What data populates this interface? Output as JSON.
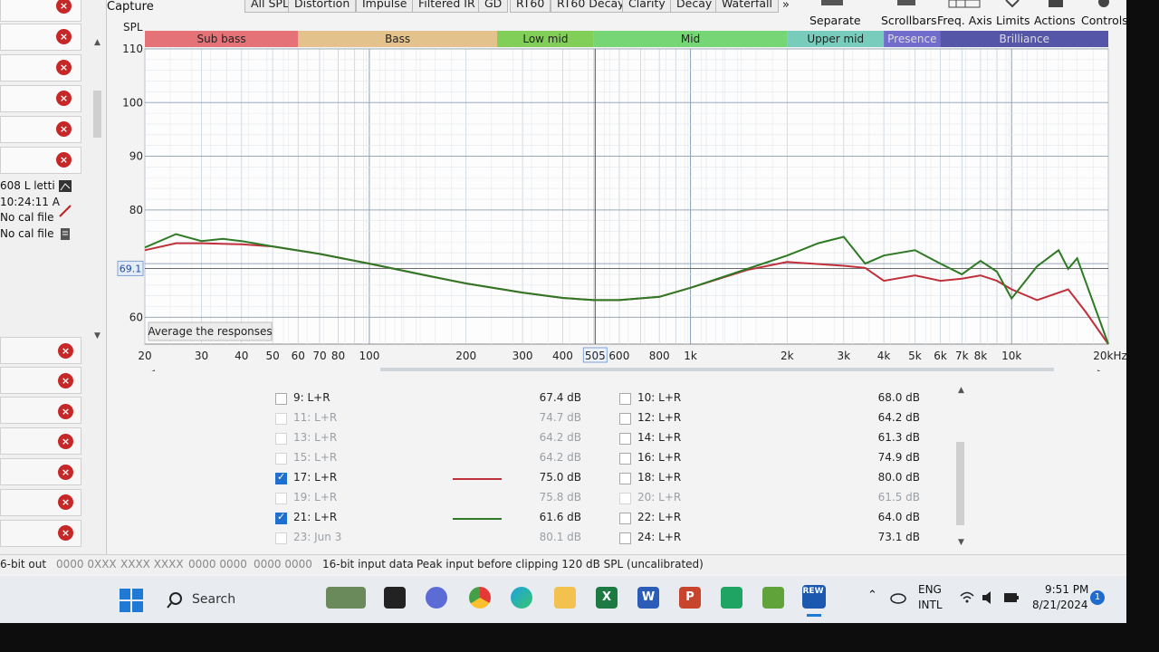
{
  "toolbar": {
    "capture": "Capture",
    "tabs": [
      "All SPL",
      "Distortion",
      "Impulse",
      "Filtered IR",
      "GD",
      "RT60",
      "RT60 Decay",
      "Clarity",
      "Decay",
      "Waterfall"
    ],
    "more": "»",
    "right_buttons": [
      "Separate",
      "Scrollbars",
      "Freq. Axis",
      "Limits",
      "Actions",
      "Controls"
    ]
  },
  "left_panel": {
    "info_lines": [
      "608 L letti",
      "10:24:11 A",
      "No cal file",
      "No cal file"
    ],
    "remove_icon": "×"
  },
  "graph": {
    "ylabel": "SPL",
    "y_ticks": [
      "110",
      "100",
      "90",
      "80",
      "60"
    ],
    "cursor_value": "69.1",
    "band_labels": [
      "Sub bass",
      "Bass",
      "Low mid",
      "Mid",
      "Upper mid",
      "Presence",
      "Brilliance"
    ],
    "band_colors": [
      "#e05a5f",
      "#e0b878",
      "#6cc83c",
      "#5fd05f",
      "#60c4b0",
      "#5b55c4",
      "#3a3a9a"
    ],
    "x_ticks": [
      "20",
      "30",
      "40",
      "50",
      "60",
      "70",
      "80",
      "100",
      "200",
      "300",
      "400",
      "505",
      "600",
      "800",
      "1k",
      "2k",
      "3k",
      "4k",
      "5k",
      "6k",
      "7k",
      "8k",
      "10k",
      "20kHz"
    ],
    "cursor_x_label": "505",
    "button": "Average the responses"
  },
  "chart_data": {
    "type": "line",
    "xlabel": "",
    "ylabel": "SPL",
    "xscale": "log",
    "xlim": [
      20,
      20000
    ],
    "ylim": [
      55,
      110
    ],
    "grid": true,
    "series": [
      {
        "name": "17: L+R",
        "color": "#c0303a",
        "x": [
          20,
          25,
          30,
          40,
          50,
          70,
          100,
          150,
          200,
          300,
          400,
          500,
          600,
          800,
          1000,
          1500,
          2000,
          3000,
          3500,
          4000,
          5000,
          6000,
          7000,
          8000,
          9000,
          10000,
          12000,
          15000,
          17000,
          20000
        ],
        "y": [
          72.5,
          73.8,
          73.8,
          73.6,
          73.2,
          71.8,
          70.0,
          67.8,
          66.3,
          64.6,
          63.6,
          63.2,
          63.2,
          63.8,
          65.5,
          68.8,
          70.3,
          69.6,
          69.2,
          66.8,
          67.8,
          66.8,
          67.2,
          67.8,
          66.8,
          65.2,
          63.2,
          65.2,
          61.0,
          50.0
        ]
      },
      {
        "name": "21: L+R",
        "color": "#2e7a24",
        "x": [
          20,
          25,
          30,
          35,
          40,
          50,
          70,
          100,
          150,
          200,
          300,
          400,
          500,
          600,
          800,
          1000,
          1500,
          2000,
          2500,
          3000,
          3500,
          4000,
          5000,
          6000,
          7000,
          8000,
          9000,
          10000,
          12000,
          14000,
          15000,
          16000,
          20000
        ],
        "y": [
          73.0,
          75.5,
          74.2,
          74.6,
          74.2,
          73.2,
          71.8,
          70.0,
          67.8,
          66.3,
          64.6,
          63.6,
          63.2,
          63.2,
          63.8,
          65.5,
          69.0,
          71.5,
          73.8,
          75.0,
          70.0,
          71.5,
          72.5,
          70.0,
          68.0,
          70.5,
          68.5,
          63.5,
          69.5,
          72.5,
          69.0,
          71.0,
          52.0
        ]
      }
    ]
  },
  "measurements": {
    "left": [
      {
        "name": "9: L+R",
        "value": "67.4 dB",
        "checked": false,
        "active": true,
        "color": ""
      },
      {
        "name": "11: L+R",
        "value": "74.7 dB",
        "checked": false,
        "active": false,
        "color": ""
      },
      {
        "name": "13: L+R",
        "value": "64.2 dB",
        "checked": false,
        "active": false,
        "color": ""
      },
      {
        "name": "15: L+R",
        "value": "64.2 dB",
        "checked": false,
        "active": false,
        "color": ""
      },
      {
        "name": "17: L+R",
        "value": "75.0 dB",
        "checked": true,
        "active": true,
        "color": "#c0303a"
      },
      {
        "name": "19: L+R",
        "value": "75.8 dB",
        "checked": false,
        "active": false,
        "color": ""
      },
      {
        "name": "21: L+R",
        "value": "61.6 dB",
        "checked": true,
        "active": true,
        "color": "#2e7a24"
      },
      {
        "name": "23: Jun 3",
        "value": "80.1 dB",
        "checked": false,
        "active": false,
        "color": ""
      }
    ],
    "right": [
      {
        "name": "10: L+R",
        "value": "68.0 dB",
        "active": true
      },
      {
        "name": "12: L+R",
        "value": "64.2 dB",
        "active": true
      },
      {
        "name": "14: L+R",
        "value": "61.3 dB",
        "active": true
      },
      {
        "name": "16: L+R",
        "value": "74.9 dB",
        "active": true
      },
      {
        "name": "18: L+R",
        "value": "80.0 dB",
        "active": true
      },
      {
        "name": "20: L+R",
        "value": "61.5 dB",
        "active": false
      },
      {
        "name": "22: L+R",
        "value": "64.0 dB",
        "active": true
      },
      {
        "name": "24: L+R",
        "value": "73.1 dB",
        "active": true
      }
    ]
  },
  "statusbar": {
    "bit_out": "6-bit out",
    "bits": [
      "0000 0XXX",
      "XXXX XXXX",
      "0000 0000",
      "0000 0000"
    ],
    "input": "16-bit input data",
    "peak": "Peak input before clipping 120 dB SPL (uncalibrated)"
  },
  "taskbar": {
    "search": "Search",
    "lang1": "ENG",
    "lang2": "INTL",
    "time": "9:51 PM",
    "date": "8/21/2024",
    "rew_label": "REW",
    "apps": [
      "chrome",
      "edge",
      "explorer",
      "excel",
      "word",
      "powerpoint",
      "sheets",
      "app",
      "rew"
    ]
  }
}
